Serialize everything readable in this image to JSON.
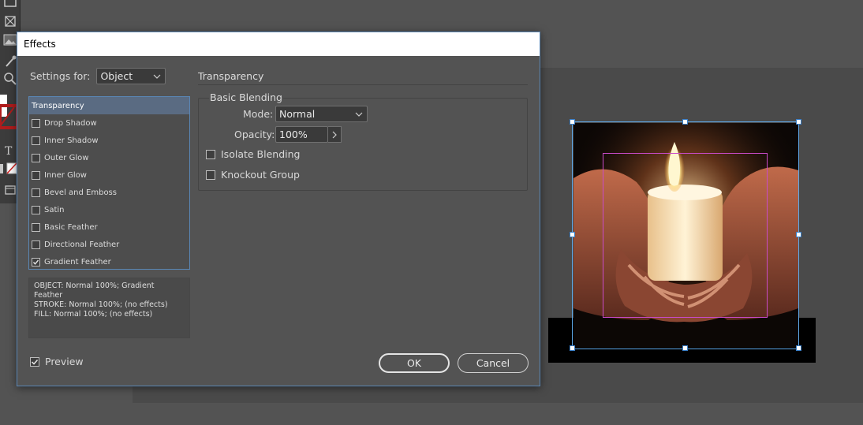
{
  "dialog": {
    "title": "Effects",
    "settings_for_label": "Settings for:",
    "settings_for_value": "Object",
    "effects": [
      {
        "label": "Transparency",
        "checked": null,
        "selected": true
      },
      {
        "label": "Drop Shadow",
        "checked": false,
        "selected": false
      },
      {
        "label": "Inner Shadow",
        "checked": false,
        "selected": false
      },
      {
        "label": "Outer Glow",
        "checked": false,
        "selected": false
      },
      {
        "label": "Inner Glow",
        "checked": false,
        "selected": false
      },
      {
        "label": "Bevel and Emboss",
        "checked": false,
        "selected": false
      },
      {
        "label": "Satin",
        "checked": false,
        "selected": false
      },
      {
        "label": "Basic Feather",
        "checked": false,
        "selected": false
      },
      {
        "label": "Directional Feather",
        "checked": false,
        "selected": false
      },
      {
        "label": "Gradient Feather",
        "checked": true,
        "selected": false
      }
    ],
    "summary": {
      "object": "OBJECT: Normal 100%; Gradient Feather",
      "stroke": "STROKE: Normal 100%; (no effects)",
      "fill": "FILL: Normal 100%; (no effects)"
    },
    "section_title": "Transparency",
    "basic_blending": {
      "title": "Basic Blending",
      "mode_label": "Mode:",
      "mode_value": "Normal",
      "opacity_label": "Opacity:",
      "opacity_value": "100%",
      "isolate_label": "Isolate Blending",
      "isolate_checked": false,
      "knockout_label": "Knockout Group",
      "knockout_checked": false
    },
    "preview_label": "Preview",
    "preview_checked": true,
    "ok_label": "OK",
    "cancel_label": "Cancel"
  },
  "colors": {
    "dialog_bg": "#535353",
    "selection_blue": "#5a86b4",
    "frame_magenta": "#c94bc9"
  },
  "icons": [
    "rectangle-frame-tool-icon",
    "frame-tool-icon",
    "place-image-icon",
    "eyedropper-icon",
    "zoom-icon",
    "type-icon",
    "swatch-icon",
    "screen-mode-icon",
    "chevron-down-icon",
    "chevron-right-icon",
    "checkmark-icon"
  ]
}
